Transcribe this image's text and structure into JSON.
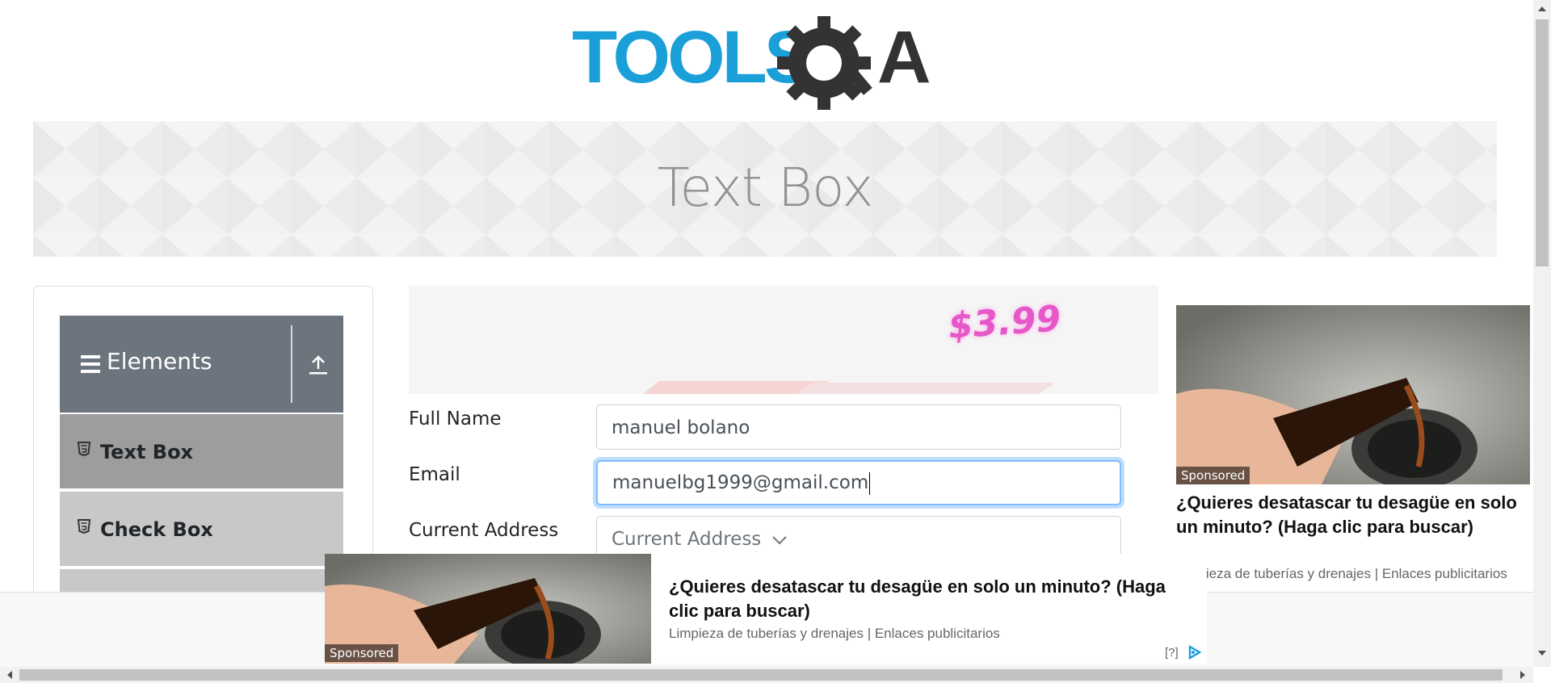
{
  "logo": {
    "text_left": "TOOLS",
    "text_right": "A"
  },
  "banner": {
    "title": "Text Box"
  },
  "sidebar": {
    "header": "Elements",
    "items": [
      {
        "label": "Text Box"
      },
      {
        "label": "Check Box"
      }
    ]
  },
  "top_ad": {
    "price": "$3.99"
  },
  "form": {
    "full_name_label": "Full Name",
    "full_name_value": "manuel bolano",
    "email_label": "Email",
    "email_value": "manuelbg1999@gmail.com",
    "address_label": "Current Address",
    "address_placeholder": "Current Address"
  },
  "right_ad": {
    "sponsored": "Sponsored",
    "headline": "¿Quieres desatascar tu desagüe en solo un minuto? (Haga clic para buscar)",
    "source": "Limpieza de tuberías y drenajes | Enlaces publicitarios"
  },
  "bottom_ad": {
    "sponsored": "Sponsored",
    "headline": "¿Quieres desatascar tu desagüe en solo un minuto? (Haga clic para buscar)",
    "source": "Limpieza de tuberías y drenajes | Enlaces publicitarios",
    "info": "[?]"
  },
  "colors": {
    "brand_blue": "#1a9fd9",
    "gear_gray": "#333333",
    "sidebar_header": "#6c757d"
  },
  "icons": [
    "gear-icon",
    "hamburger-icon",
    "upload-icon",
    "html5-icon",
    "adchoices-icon"
  ]
}
